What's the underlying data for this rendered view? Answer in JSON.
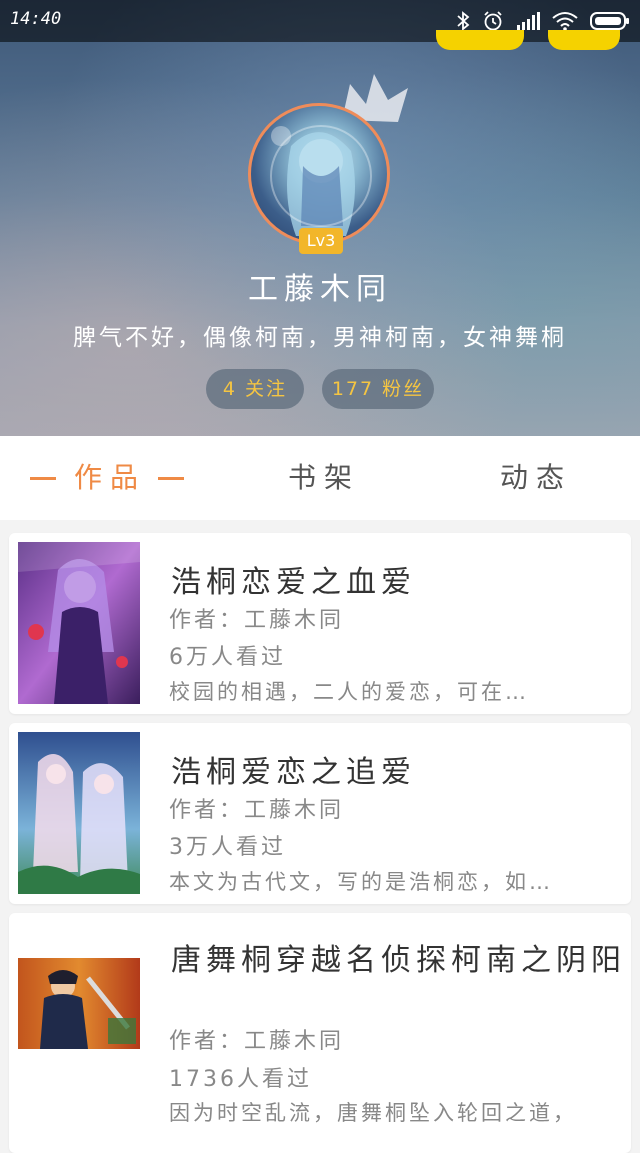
{
  "status_bar": {
    "time": "14:40"
  },
  "profile": {
    "level": "Lv3",
    "username": "工藤木同",
    "bio": "脾气不好，偶像柯南，男神柯南，女神舞桐",
    "following": "4 关注",
    "followers": "177 粉丝"
  },
  "tabs": [
    {
      "label": "作品",
      "active": true
    },
    {
      "label": "书架",
      "active": false
    },
    {
      "label": "动态",
      "active": false
    }
  ],
  "books": [
    {
      "title": "浩桐恋爱之血爱",
      "author": "作者：工藤木同",
      "views": "6万人看过",
      "desc": "校园的相遇，二人的爱恋，可在…"
    },
    {
      "title": "浩桐爱恋之追爱",
      "author": "作者：工藤木同",
      "views": "3万人看过",
      "desc": "本文为古代文，写的是浩桐恋，如…"
    },
    {
      "title": "唐舞桐穿越名侦探柯南之阴阳",
      "author": "作者：工藤木同",
      "views": "1736人看过",
      "desc": "因为时空乱流，唐舞桐坠入轮回之道，"
    }
  ],
  "colors": {
    "accent": "#ef8a45",
    "badge": "#f2b62a",
    "pill_text": "#f5c542"
  }
}
